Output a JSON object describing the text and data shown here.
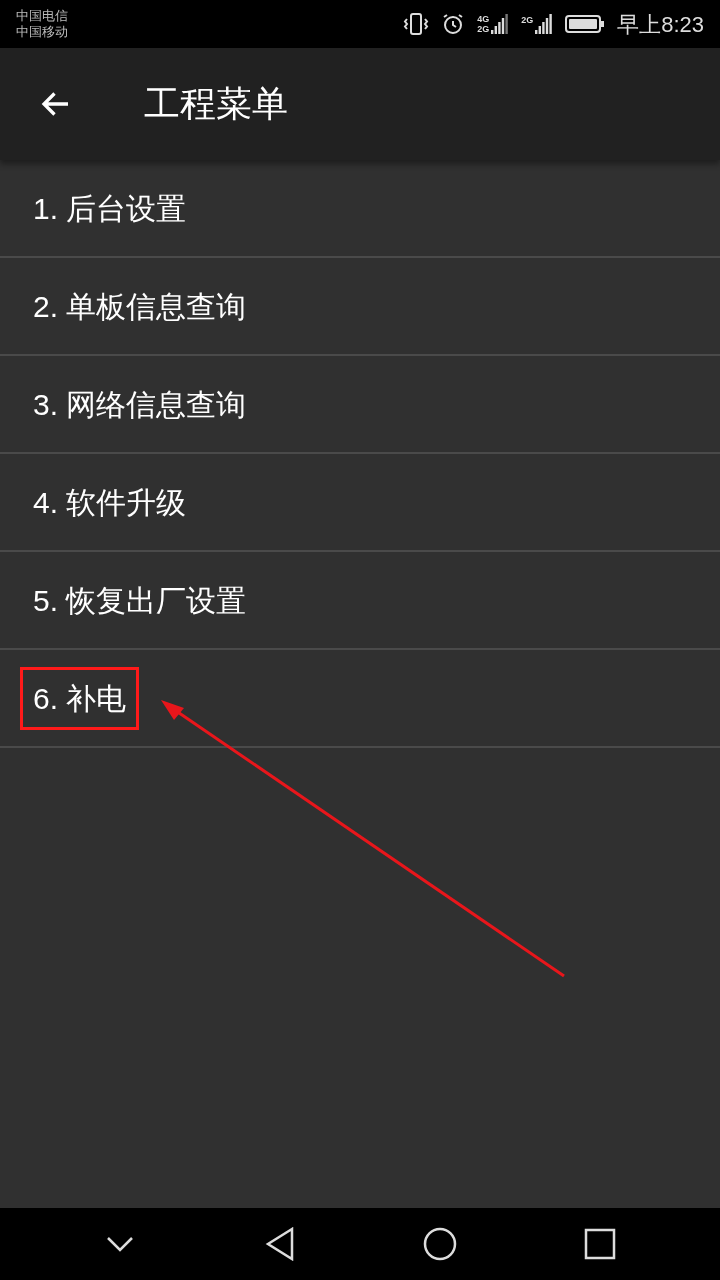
{
  "status_bar": {
    "carriers": [
      "中国电信",
      "中国移动"
    ],
    "network_labels": [
      "4G",
      "2G",
      "2G"
    ],
    "time": "早上8:23"
  },
  "toolbar": {
    "title": "工程菜单"
  },
  "menu_items": [
    {
      "label": "1. 后台设置",
      "highlighted": false
    },
    {
      "label": "2. 单板信息查询",
      "highlighted": false
    },
    {
      "label": "3. 网络信息查询",
      "highlighted": false
    },
    {
      "label": "4. 软件升级",
      "highlighted": false
    },
    {
      "label": "5. 恢复出厂设置",
      "highlighted": false
    },
    {
      "label": "6. 补电",
      "highlighted": true
    }
  ]
}
